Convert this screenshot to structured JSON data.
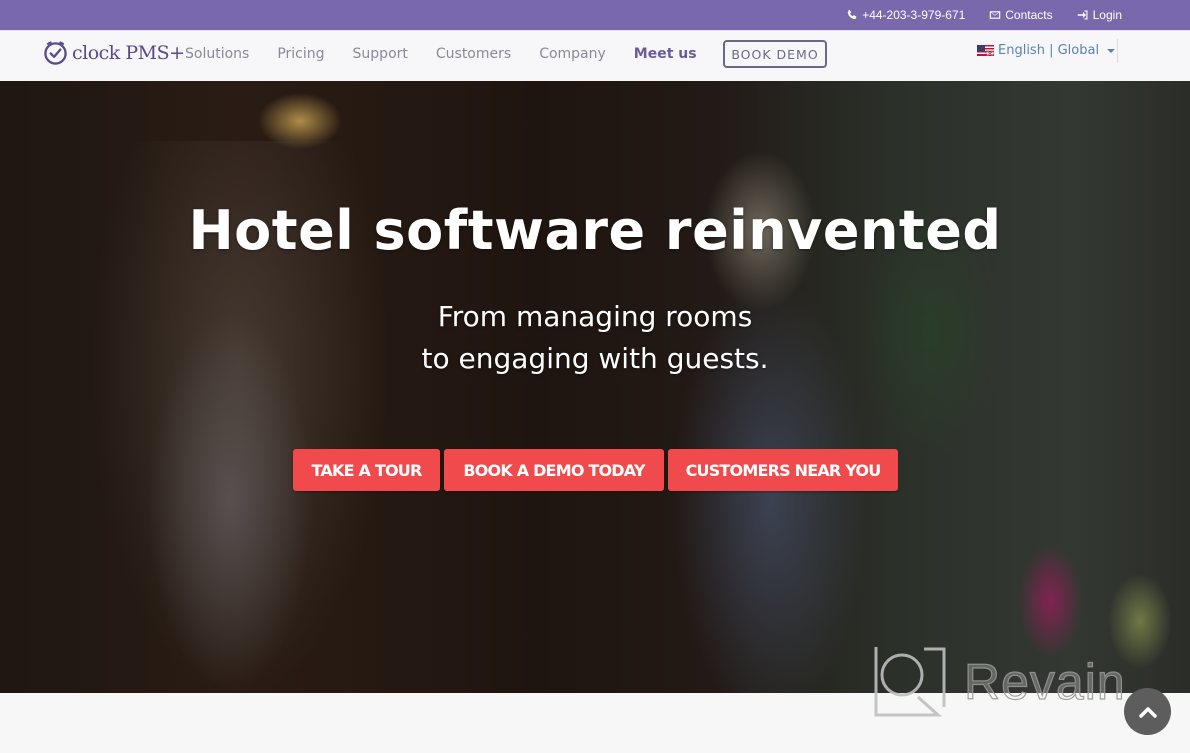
{
  "topbar": {
    "phone": "+44-203-3-979-671",
    "contacts": "Contacts",
    "login": "Login",
    "icons": {
      "phone": "phone-icon",
      "contacts": "envelope-icon",
      "login": "sign-in-icon"
    },
    "background_color": "#7a68ad"
  },
  "navbar": {
    "logo_text": "clock PMS+",
    "links": [
      {
        "label": "Solutions"
      },
      {
        "label": "Pricing"
      },
      {
        "label": "Support"
      },
      {
        "label": "Customers"
      },
      {
        "label": "Company"
      },
      {
        "label": "Meet us"
      }
    ],
    "book_demo": "BOOK DEMO",
    "language": "English | Global"
  },
  "hero": {
    "title": "Hotel software reinvented",
    "subtitle_line1": "From managing rooms",
    "subtitle_line2": "to engaging with guests.",
    "buttons": [
      {
        "label": "TAKE A TOUR"
      },
      {
        "label": "BOOK A DEMO TODAY"
      },
      {
        "label": "CUSTOMERS NEAR YOU"
      }
    ],
    "button_color": "#f04a4c"
  },
  "watermark": {
    "text": "Revain"
  },
  "scroll_top": {
    "icon": "chevron-up-icon"
  }
}
